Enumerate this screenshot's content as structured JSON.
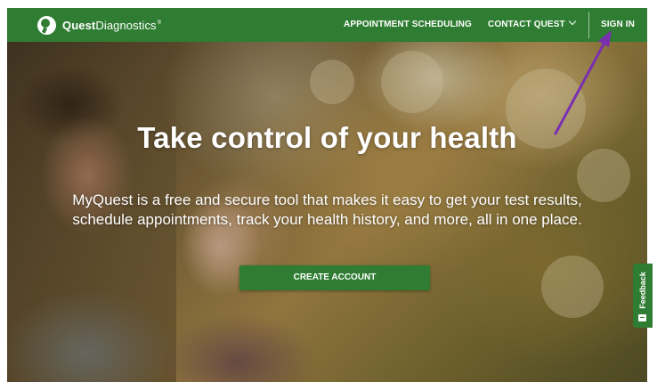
{
  "brand": {
    "name_bold": "Quest",
    "name_light": "Diagnostics",
    "trademark": "®"
  },
  "nav": {
    "appointment": "APPOINTMENT SCHEDULING",
    "contact": "CONTACT QUEST",
    "signin": "SIGN IN"
  },
  "hero": {
    "title": "Take control of your health",
    "body": "MyQuest is a free and secure tool that makes it easy to get your test results, schedule appointments, track your health history, and more, all in one place.",
    "cta": "CREATE ACCOUNT"
  },
  "feedback": {
    "label": "Feedback"
  },
  "colors": {
    "brand_green": "#2f7d32",
    "annotation_arrow": "#7a2fb0"
  },
  "icons": {
    "logo": "quest-logo-icon",
    "contact_chevron": "chevron-down-icon",
    "feedback": "feedback-icon",
    "annotation": "arrow-annotation-icon"
  }
}
